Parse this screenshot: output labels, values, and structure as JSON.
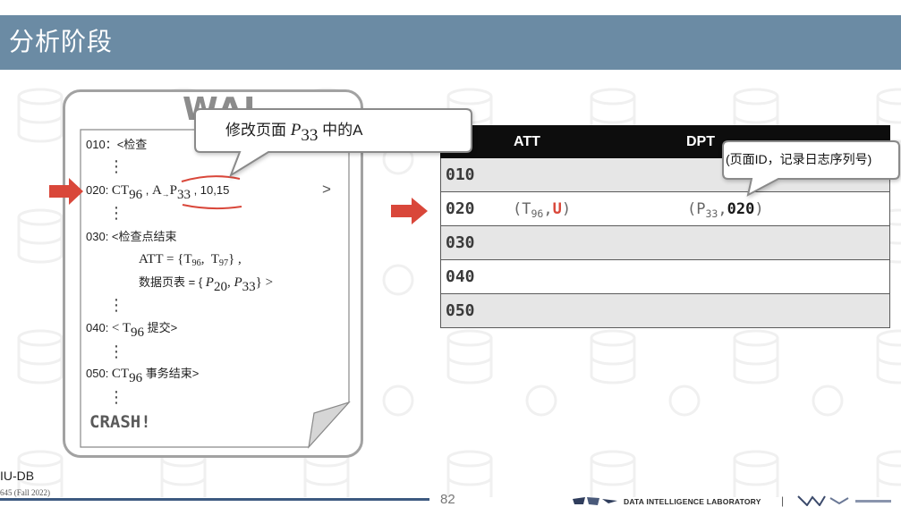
{
  "slide": {
    "title": "分析阶段"
  },
  "wal": {
    "label": "WAL",
    "dots": "⋮",
    "line010": "010：<检查",
    "line020": [
      "020: ",
      "CT",
      "96",
      " , ",
      "A",
      "→",
      "P",
      "33",
      " , 10,15"
    ],
    "line020_more": ">",
    "line030": "030: <检查点结束",
    "att_line": [
      "ATT = {T",
      "96",
      ",  T",
      "97",
      "} ,"
    ],
    "dpt_line": [
      "数据页表 = { ",
      "P",
      "20",
      ", ",
      "P",
      "33",
      "} >"
    ],
    "line040": [
      "040: ",
      "< T",
      "96",
      " 提交>"
    ],
    "line050": [
      "050: ",
      "CT",
      "96",
      " 事务结束>"
    ],
    "crash": "CRASH!"
  },
  "callout_log": [
    "修改页面 ",
    "P",
    "33",
    " 中的A"
  ],
  "table": {
    "headers": [
      "ATT",
      "DPT"
    ],
    "rows": [
      {
        "lsn": "010"
      },
      {
        "lsn": "020",
        "att": [
          "(T",
          "96",
          ",",
          "U",
          ")"
        ],
        "dpt": [
          "(P",
          "33",
          ",",
          "020",
          ")"
        ]
      },
      {
        "lsn": "030"
      },
      {
        "lsn": "040"
      },
      {
        "lsn": "050"
      }
    ]
  },
  "callout_dpt": "(页面ID，记录日志序列号)",
  "footer": {
    "course": "IU-DB",
    "term": "645 (Fall 2022)",
    "page": "82",
    "lab": "DATA INTELLIGENCE LABORATORY",
    "separator": "|"
  },
  "colors": {
    "title_bar": "#6b8ba4",
    "accent_red": "#d9473a",
    "table_header": "#0d0d0d",
    "row_shade": "#e6e6e6",
    "footer_line": "#3d5a80"
  }
}
